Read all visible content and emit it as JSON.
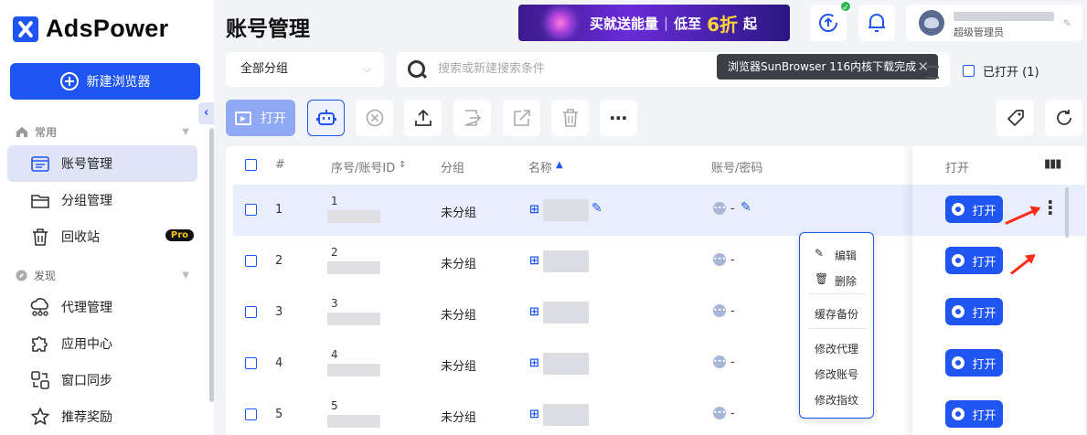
{
  "app": {
    "brand": "AdsPower",
    "new_browser_label": "新建浏览器"
  },
  "sidebar": {
    "section_common": "常用",
    "section_discover": "发现",
    "items": [
      {
        "label": "账号管理"
      },
      {
        "label": "分组管理"
      },
      {
        "label": "回收站",
        "badge": "Pro"
      },
      {
        "label": "代理管理"
      },
      {
        "label": "应用中心"
      },
      {
        "label": "窗口同步"
      },
      {
        "label": "推荐奖励"
      }
    ]
  },
  "header": {
    "title": "账号管理",
    "banner": {
      "text1": "买就送能量",
      "sep": "|",
      "text2": "低至",
      "discount": "6折",
      "text3": "起"
    },
    "user_role": "超级管理员"
  },
  "filters": {
    "group_select": "全部分组",
    "search_placeholder": "搜索或新建搜索条件",
    "toast": "浏览器SunBrowser 116内核下载完成",
    "opened_label": "已打开 (1)"
  },
  "toolbar": {
    "open_label": "打开"
  },
  "table": {
    "headers": {
      "index": "#",
      "serial": "序号/账号ID",
      "group": "分组",
      "name": "名称",
      "account": "账号/密码",
      "open": "打开"
    },
    "rows": [
      {
        "num": "1",
        "serial": "1",
        "group": "未分组",
        "account": "-",
        "open": "打开"
      },
      {
        "num": "2",
        "serial": "2",
        "group": "未分组",
        "account": "-",
        "open": "打开"
      },
      {
        "num": "3",
        "serial": "3",
        "group": "未分组",
        "account": "-",
        "open": "打开"
      },
      {
        "num": "4",
        "serial": "4",
        "group": "未分组",
        "account": "-",
        "open": "打开"
      },
      {
        "num": "5",
        "serial": "5",
        "group": "未分组",
        "account": "-",
        "open": "打开"
      }
    ]
  },
  "context_menu": {
    "edit": "编辑",
    "delete": "删除",
    "cache_backup": "缓存备份",
    "edit_proxy": "修改代理",
    "edit_account": "修改账号",
    "edit_fingerprint": "修改指纹"
  },
  "colors": {
    "accent": "#1f55f0",
    "arrow": "#ff2a1a",
    "active_bg": "#dfe5f7"
  }
}
